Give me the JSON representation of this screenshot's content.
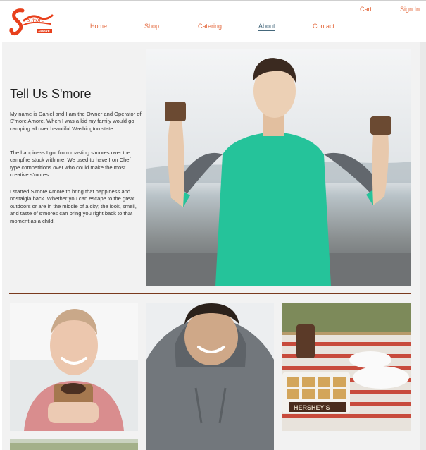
{
  "brand": {
    "logo_text": "S'more",
    "logo_subtext": "AMORE",
    "logo_color": "#e8401c"
  },
  "nav": {
    "items": [
      {
        "label": "Home"
      },
      {
        "label": "Shop"
      },
      {
        "label": "Catering"
      },
      {
        "label": "About"
      },
      {
        "label": "Contact"
      }
    ],
    "active": "About"
  },
  "utility": {
    "cart": "Cart",
    "sign_in": "Sign In"
  },
  "about": {
    "heading": "Tell Us S'more",
    "paragraphs": [
      "My name is Daniel and I am the Owner and Operator of S'more Amore. When I was a kid my family would go camping all over beautiful Washington state.",
      "The happiness I got from roasting s'mores over the campfire stuck with me. We used to have Iron Chef type competitions over who could make the most creative s'mores.",
      "I started S'more Amore to bring that happiness and nostalgia back.  Whether you can escape to the great outdoors or are in the middle of a city; the look, smell, and taste of s'mores can bring you right back to that moment as a child."
    ]
  },
  "photos": {
    "hero": "man-holding-smores-photo",
    "gallery": [
      "woman-eating-smore-photo",
      "man-smiling-photo",
      "picnic-table-smores-photo",
      "outdoor-scene-photo"
    ]
  },
  "colors": {
    "accent": "#e3673b",
    "active_nav": "#44677b",
    "divider": "#7a3a1e",
    "panel_bg": "#f2f2f2"
  }
}
